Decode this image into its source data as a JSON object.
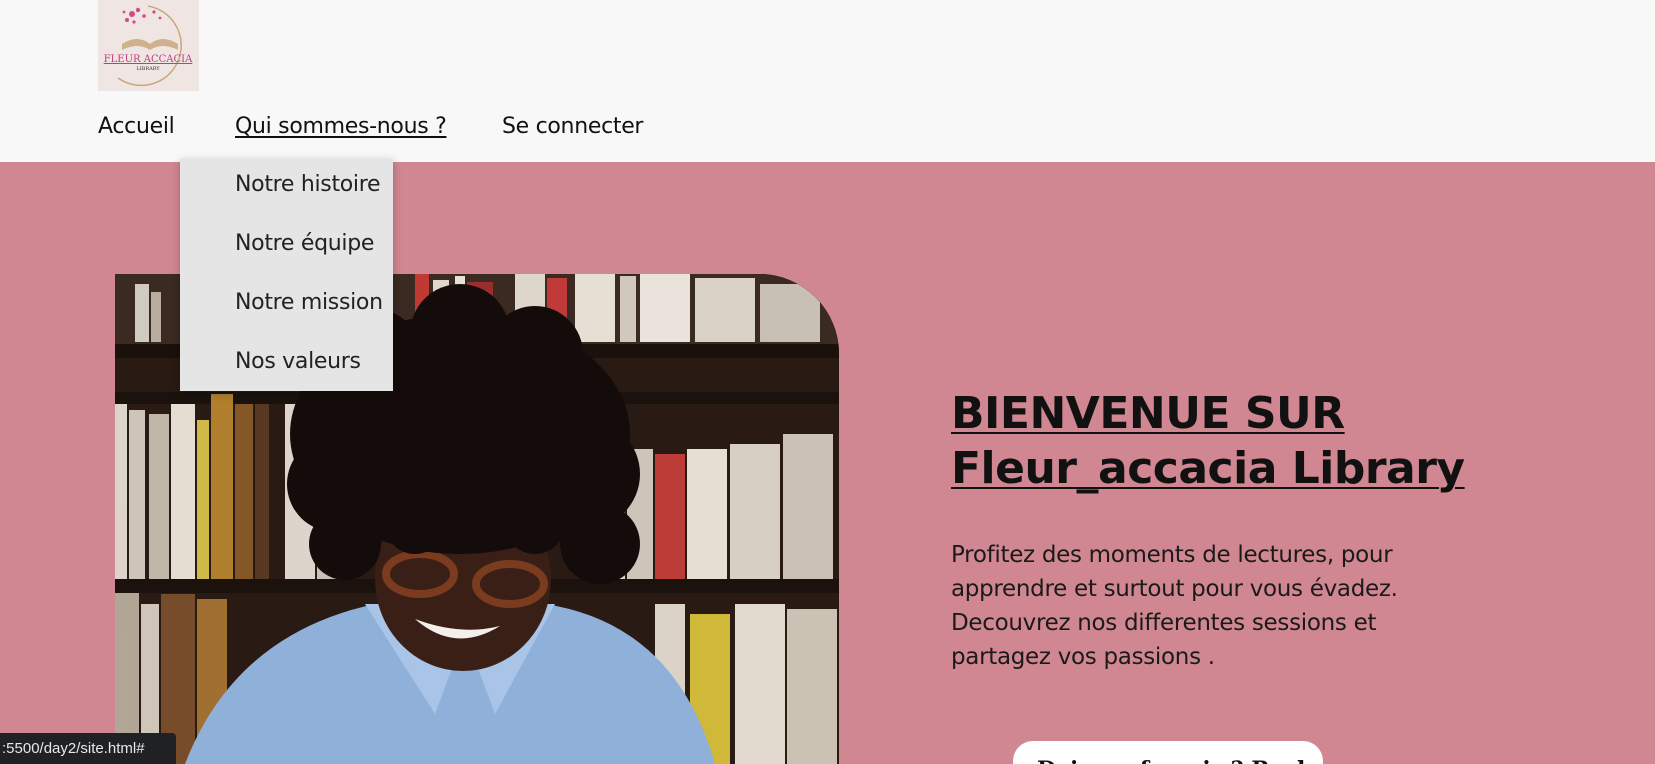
{
  "header": {
    "logo": {
      "text": "FLEUR ACCACIA",
      "subtext": "LIBRARY"
    },
    "nav": [
      {
        "label": "Accueil"
      },
      {
        "label": "Qui sommes-nous ?"
      },
      {
        "label": "Se connecter"
      }
    ],
    "dropdown": [
      {
        "label": "Notre histoire"
      },
      {
        "label": "Notre équipe"
      },
      {
        "label": "Notre mission"
      },
      {
        "label": "Nos valeurs"
      }
    ]
  },
  "hero": {
    "title_line1": "BIENVENUE SUR",
    "title_line2": "Fleur_accacia Library",
    "paragraph": "Profitez des moments de lectures, pour apprendre et surtout pour vous évadez. Decouvrez nos differentes sessions et partagez vos passions .",
    "cta_label": "Deja un favoris ? Recherchez",
    "image_alt_icon": "person-reading-photo"
  },
  "status_bar": {
    "url": ":5500/day2/site.html#"
  },
  "colors": {
    "header_bg": "#f8f8f8",
    "hero_bg": "#d08791",
    "dropdown_bg": "#e5e5e5",
    "accent_logo": "#d24a8a"
  }
}
